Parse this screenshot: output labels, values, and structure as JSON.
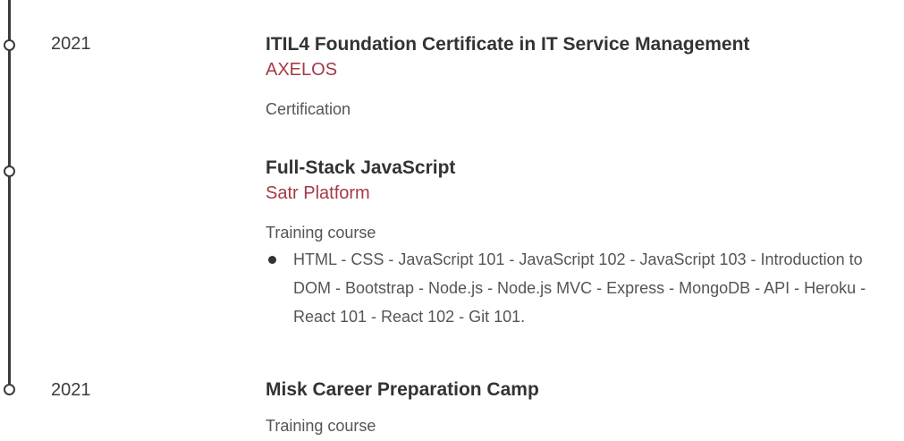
{
  "entries": [
    {
      "year": "2021",
      "title": "ITIL4 Foundation Certificate in IT Service Management",
      "organization": "AXELOS",
      "type": "Certification"
    },
    {
      "year": "",
      "title": "Full-Stack JavaScript",
      "organization": "Satr Platform",
      "type": "Training course",
      "bullets": [
        "HTML - CSS - JavaScript 101 - JavaScript 102 - JavaScript 103 - Introduction to DOM - Bootstrap - Node.js - Node.js MVC - Express - MongoDB - API - Heroku - React 101 - React 102 - Git 101."
      ]
    },
    {
      "year": "2021",
      "title": "Misk Career Preparation Camp",
      "organization": "",
      "type": "Training course"
    }
  ],
  "colors": {
    "accent": "#a33a45",
    "timeline": "#3b3b3b"
  }
}
